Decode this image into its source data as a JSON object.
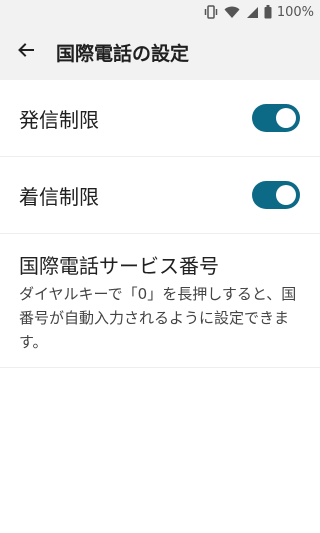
{
  "status_bar": {
    "battery": "100%",
    "icons": [
      "vibrate-icon",
      "wifi-icon",
      "signal-icon",
      "battery-icon"
    ]
  },
  "app_bar": {
    "back_icon": "arrow-left-icon",
    "title": "国際電話の設定"
  },
  "settings": {
    "outgoing_restriction": {
      "label": "発信制限",
      "enabled": true
    },
    "incoming_restriction": {
      "label": "着信制限",
      "enabled": true
    },
    "intl_service_number": {
      "title": "国際電話サービス番号",
      "description": "ダイヤルキーで「0」を長押しすると、国番号が自動入力されるように設定できます。"
    }
  },
  "colors": {
    "switch_on": "#0d6a86",
    "bar_background": "#f2f2f2"
  }
}
